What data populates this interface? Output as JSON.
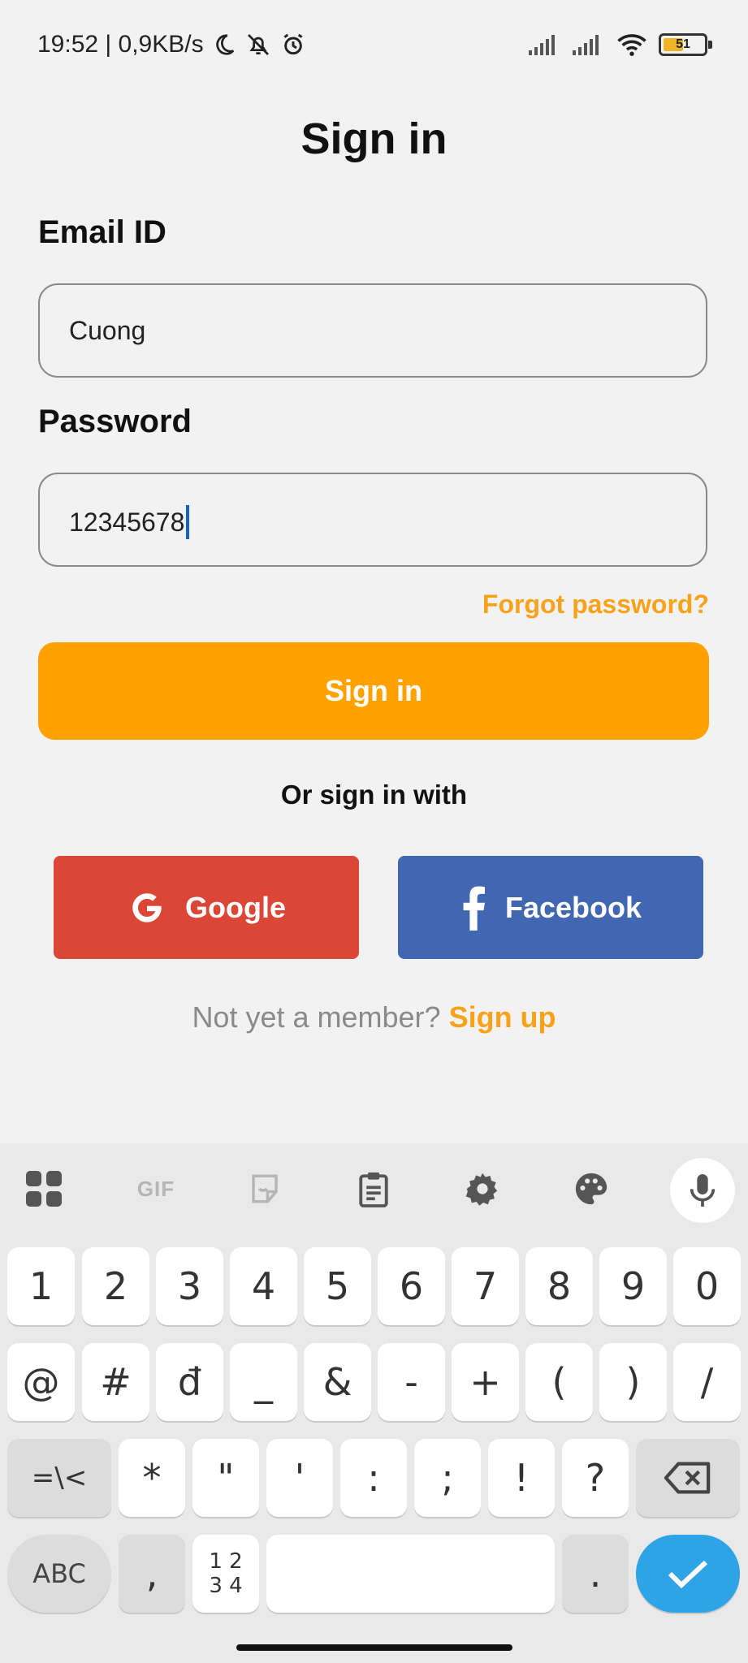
{
  "status_bar": {
    "time_speed": "19:52 | 0,9KB/s",
    "battery_level": "51",
    "icons": [
      "moon-icon",
      "muted-bell-icon",
      "alarm-icon",
      "signal-icon",
      "signal-icon",
      "wifi-icon",
      "battery-icon"
    ]
  },
  "page": {
    "title": "Sign in",
    "email_label": "Email ID",
    "email_value": "Cuong",
    "password_label": "Password",
    "password_value": "12345678",
    "forgot_label": "Forgot password?",
    "signin_label": "Sign in",
    "or_label": "Or sign in with",
    "google_label": "Google",
    "facebook_label": "Facebook",
    "member_text": "Not yet a member?",
    "signup_label": "Sign up"
  },
  "colors": {
    "accent": "#ffa200",
    "link": "#f7a21b",
    "google": "#dc4637",
    "facebook": "#4267b2",
    "enter_key": "#2ea3e6"
  },
  "keyboard": {
    "toolbar": [
      "apps-icon",
      "gif-icon",
      "sticker-icon",
      "clipboard-icon",
      "settings-icon",
      "palette-icon",
      "mic-icon"
    ],
    "gif_label": "GIF",
    "row1": [
      "1",
      "2",
      "3",
      "4",
      "5",
      "6",
      "7",
      "8",
      "9",
      "0"
    ],
    "row2": [
      "@",
      "#",
      "đ",
      "_",
      "&",
      "-",
      "+",
      "(",
      ")",
      "/"
    ],
    "row3_left": "=\\<",
    "row3": [
      "*",
      "\"",
      "'",
      ":",
      ";",
      "!",
      "?"
    ],
    "abc_label": "ABC",
    "comma": ",",
    "num_top": "1 2",
    "num_bottom": "3 4",
    "period": "."
  }
}
